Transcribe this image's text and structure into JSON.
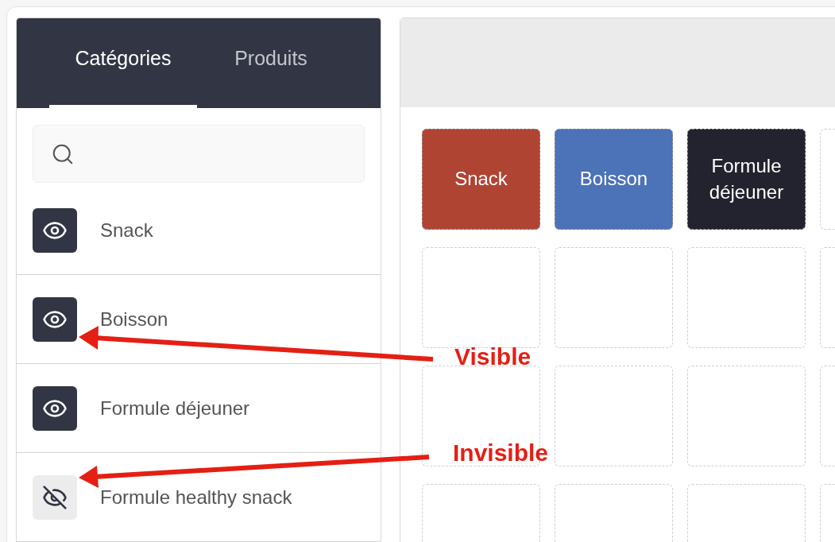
{
  "sidebar": {
    "tabs": [
      {
        "label": "Catégories",
        "selected": true
      },
      {
        "label": "Produits",
        "selected": false
      }
    ],
    "items": [
      {
        "label": "Snack",
        "visible": true
      },
      {
        "label": "Boisson",
        "visible": true
      },
      {
        "label": "Formule déjeuner",
        "visible": true
      },
      {
        "label": "Formule healthy snack",
        "visible": false
      }
    ]
  },
  "grid": {
    "tiles": [
      {
        "kind": "category",
        "label": "Snack",
        "color": "#b04433"
      },
      {
        "kind": "category",
        "label": "Boisson",
        "color": "#4c72b8"
      },
      {
        "kind": "category",
        "label": "Formule déjeuner",
        "color": "#22232e"
      },
      {
        "kind": "empty"
      },
      {
        "kind": "empty"
      },
      {
        "kind": "empty"
      },
      {
        "kind": "empty"
      },
      {
        "kind": "empty"
      },
      {
        "kind": "empty"
      },
      {
        "kind": "empty"
      },
      {
        "kind": "empty"
      },
      {
        "kind": "empty"
      },
      {
        "kind": "empty"
      },
      {
        "kind": "empty"
      },
      {
        "kind": "empty"
      },
      {
        "kind": "empty"
      }
    ]
  },
  "annotations": [
    {
      "label": "Visible"
    },
    {
      "label": "Invisible"
    }
  ]
}
